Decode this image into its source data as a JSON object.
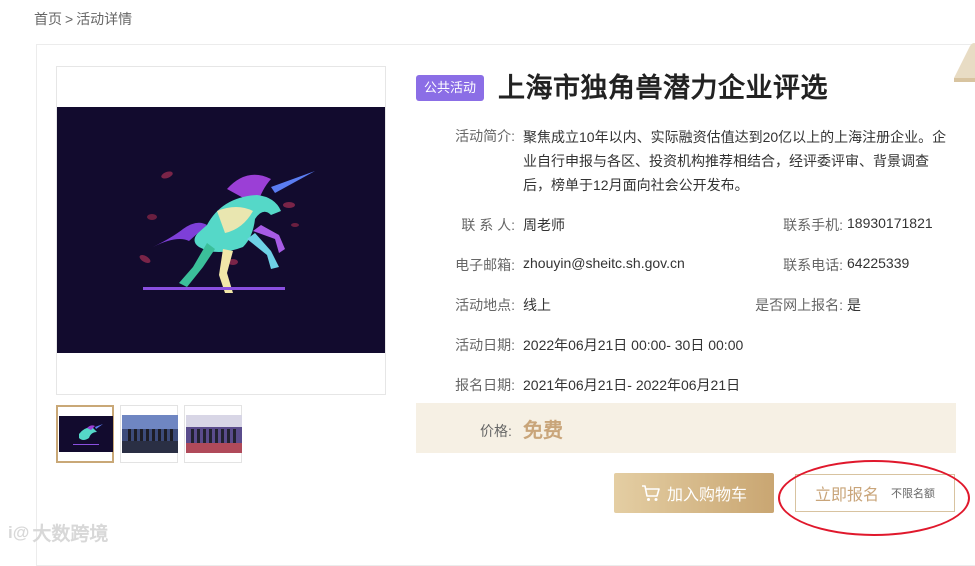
{
  "breadcrumb": {
    "home": "首页",
    "sep": ">",
    "current": "活动详情"
  },
  "activity": {
    "tag": "公共活动",
    "title": "上海市独角兽潜力企业评选",
    "intro_label": "活动简介:",
    "intro": "聚焦成立10年以内、实际融资估值达到20亿以上的上海注册企业。企业自行申报与各区、投资机构推荐相结合，经评委评审、背景调查后，榜单于12月面向社会公开发布。",
    "contact_label": "联 系 人:",
    "contact": "周老师",
    "mobile_label": "联系手机:",
    "mobile": "18930171821",
    "email_label": "电子邮箱:",
    "email": "zhouyin@sheitc.sh.gov.cn",
    "phone_label": "联系电话:",
    "phone": "64225339",
    "location_label": "活动地点:",
    "location": "线上",
    "online_label": "是否网上报名:",
    "online": "是",
    "date_label": "活动日期:",
    "date": "2022年06月21日 00:00- 30日 00:00",
    "signup_label": "报名日期:",
    "signup": "2021年06月21日- 2022年06月21日",
    "price_label": "价格:",
    "price": "免费"
  },
  "buttons": {
    "cart": "加入购物车",
    "register": "立即报名",
    "register_note": "不限名额"
  },
  "gallery": {
    "thumbs": [
      "unicorn-image",
      "ceremony-photo-1",
      "ceremony-photo-2"
    ],
    "active_index": 0
  },
  "watermark": {
    "logo": "i@",
    "text": "大数跨境"
  },
  "colors": {
    "tag": "#8b6ee6",
    "gold": "#c9a57a",
    "price_bg": "#f6f0e4",
    "highlight": "#e0182c",
    "image_bg": "#120b2e"
  }
}
